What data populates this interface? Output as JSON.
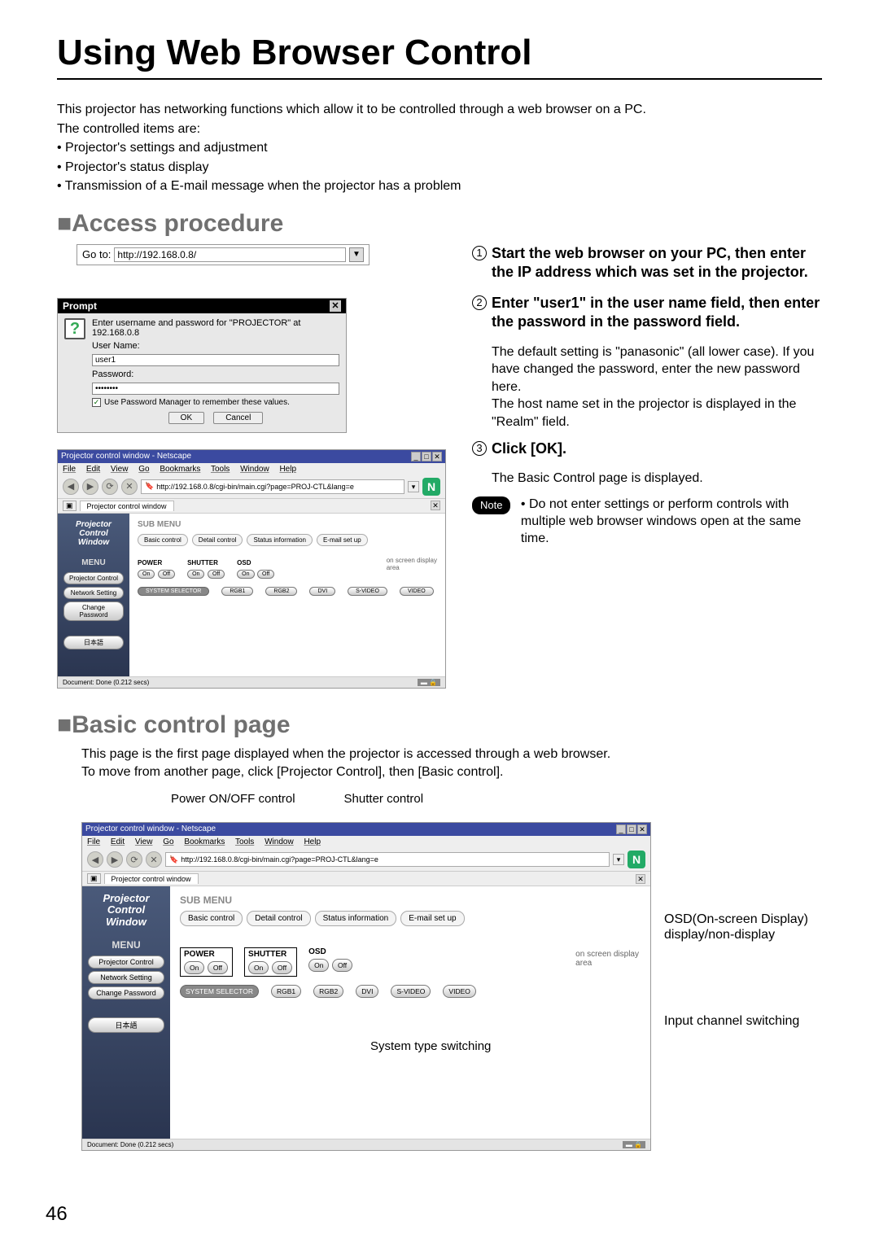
{
  "title": "Using Web Browser Control",
  "intro": {
    "line1": "This projector has networking functions which allow it to be controlled through a web browser on a PC.",
    "line2": "The controlled items are:",
    "bullet1": "• Projector's settings and adjustment",
    "bullet2": "• Projector's status display",
    "bullet3": "• Transmission of a E-mail message when the projector has a problem"
  },
  "sectionAccess": "■Access procedure",
  "goto": {
    "label": "Go to:",
    "url": "http://192.168.0.8/"
  },
  "prompt": {
    "title": "Prompt",
    "msg": "Enter username and password for \"PROJECTOR\" at 192.168.0.8",
    "userLabel": "User Name:",
    "userValue": "user1",
    "passLabel": "Password:",
    "passValue": "••••••••",
    "remember": "Use Password Manager to remember these values.",
    "ok": "OK",
    "cancel": "Cancel"
  },
  "steps": {
    "s1": "Start the web browser on your PC, then enter the IP address which was set in the projector.",
    "s2": "Enter \"user1\" in the user name field, then enter the password in the password field.",
    "s2sub1": "The default setting is \"panasonic\" (all lower case). If you have changed the password, enter the new password here.",
    "s2sub2": "The host name set in the projector is displayed in the \"Realm\" field.",
    "s3": "Click [OK].",
    "s3sub": "The Basic Control page is displayed.",
    "noteLabel": "Note",
    "noteText": "• Do not enter settings or perform controls with multiple web browser windows open at the same time."
  },
  "browser": {
    "title": "Projector control window - Netscape",
    "menubar": [
      "File",
      "Edit",
      "View",
      "Go",
      "Bookmarks",
      "Tools",
      "Window",
      "Help"
    ],
    "urlText": "http://192.168.0.8/cgi-bin/main.cgi?page=PROJ-CTL&lang=e",
    "tab": "Projector control window",
    "sidebar": {
      "logo1": "Projector",
      "logo2": "Control",
      "logo3": "Window",
      "menuLabel": "MENU",
      "items": [
        "Projector Control",
        "Network Setting",
        "Change Password",
        "日本語"
      ]
    },
    "submenu": "SUB MENU",
    "tabs": [
      "Basic control",
      "Detail control",
      "Status information",
      "E-mail set up"
    ],
    "controls": {
      "power": "POWER",
      "shutter": "SHUTTER",
      "osd": "OSD",
      "on": "On",
      "off": "Off",
      "system": "SYSTEM SELECTOR",
      "inputs": [
        "RGB1",
        "RGB2",
        "DVI",
        "S-VIDEO",
        "VIDEO"
      ]
    },
    "osdArea1": "on screen display",
    "osdArea2": "area",
    "status": "Document: Done (0.212 secs)"
  },
  "sectionBasic": "■Basic control page",
  "basicDesc1": "This page is the first page displayed when the projector is accessed through a web browser.",
  "basicDesc2": "To move from another page, click [Projector Control], then [Basic control].",
  "callouts": {
    "power": "Power ON/OFF control",
    "shutter": "Shutter control",
    "osd1": "OSD(On-screen Display)",
    "osd2": "display/non-display",
    "input": "Input channel switching",
    "system": "System type switching"
  },
  "pageNumber": "46"
}
